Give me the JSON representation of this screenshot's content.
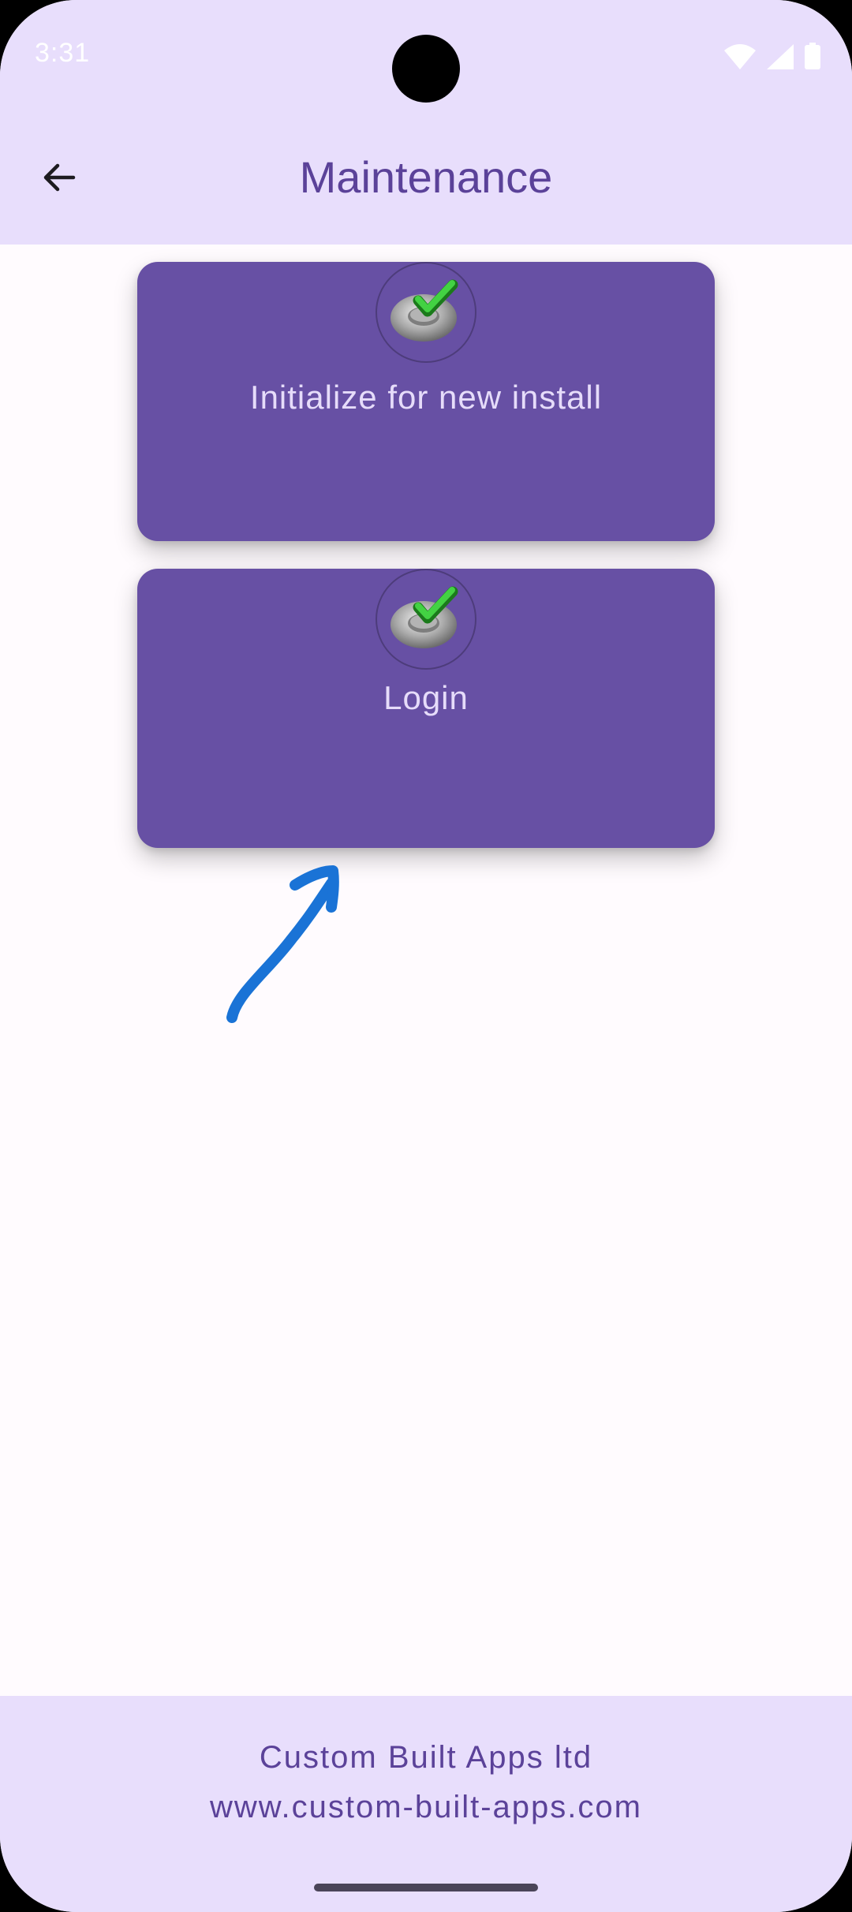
{
  "status_bar": {
    "time": "3:31",
    "icons": [
      "wifi-icon",
      "signal-icon",
      "battery-icon"
    ]
  },
  "app_bar": {
    "back_icon": "arrow-left-icon",
    "title": "Maintenance"
  },
  "cards": [
    {
      "icon": "green-check-ring-icon",
      "label": "Initialize for new install"
    },
    {
      "icon": "green-check-ring-icon",
      "label": "Login"
    }
  ],
  "annotation": {
    "icon": "blue-hand-drawn-arrow-icon",
    "color": "#1a73d6"
  },
  "footer": {
    "company": "Custom Built Apps ltd",
    "url": "www.custom-built-apps.com"
  },
  "colors": {
    "primary": "#6750a4",
    "surface_tint": "#e8defc",
    "title": "#5b4299",
    "card_text": "#e6dcfa"
  }
}
